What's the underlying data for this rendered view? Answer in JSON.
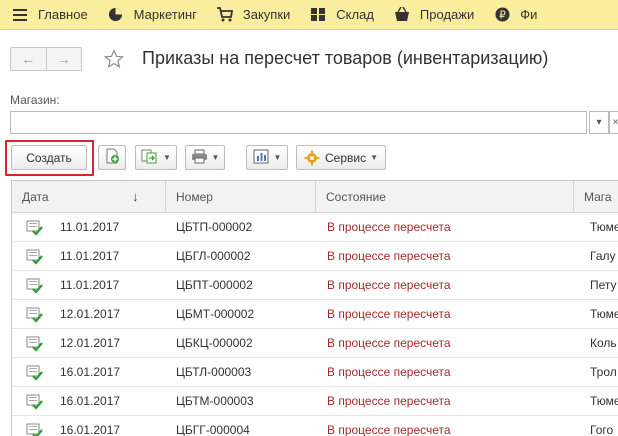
{
  "menu": {
    "items": [
      {
        "label": "Главное",
        "icon": "hamburger-icon"
      },
      {
        "label": "Маркетинг",
        "icon": "pie-chart-icon"
      },
      {
        "label": "Закупки",
        "icon": "cart-icon"
      },
      {
        "label": "Склад",
        "icon": "warehouse-icon"
      },
      {
        "label": "Продажи",
        "icon": "basket-icon"
      },
      {
        "label": "Фи",
        "icon": "ruble-icon"
      }
    ]
  },
  "nav": {
    "back": "←",
    "forward": "→"
  },
  "page": {
    "title": "Приказы на пересчет товаров (инвентаризацию)"
  },
  "filter": {
    "label": "Магазин:",
    "value": ""
  },
  "toolbar": {
    "create_label": "Создать",
    "service_label": "Сервис"
  },
  "table": {
    "columns": [
      "Дата",
      "Номер",
      "Состояние",
      "Мага"
    ],
    "sort_indicator": "↓",
    "rows": [
      {
        "date": "11.01.2017",
        "number": "ЦБТП-000002",
        "status": "В процессе пересчета",
        "store": "Тюме"
      },
      {
        "date": "11.01.2017",
        "number": "ЦБГЛ-000002",
        "status": "В процессе пересчета",
        "store": "Галу"
      },
      {
        "date": "11.01.2017",
        "number": "ЦБПТ-000002",
        "status": "В процессе пересчета",
        "store": "Пету"
      },
      {
        "date": "12.01.2017",
        "number": "ЦБМТ-000002",
        "status": "В процессе пересчета",
        "store": "Тюме"
      },
      {
        "date": "12.01.2017",
        "number": "ЦБКЦ-000002",
        "status": "В процессе пересчета",
        "store": "Коль"
      },
      {
        "date": "16.01.2017",
        "number": "ЦБТЛ-000003",
        "status": "В процессе пересчета",
        "store": "Трол"
      },
      {
        "date": "16.01.2017",
        "number": "ЦБТМ-000003",
        "status": "В процессе пересчета",
        "store": "Тюме"
      },
      {
        "date": "16.01.2017",
        "number": "ЦБГГ-000004",
        "status": "В процессе пересчета",
        "store": "Гого"
      }
    ]
  },
  "colors": {
    "menubar": "#fbed9e",
    "status_text": "#a52a2a",
    "highlight": "#d9252b"
  }
}
